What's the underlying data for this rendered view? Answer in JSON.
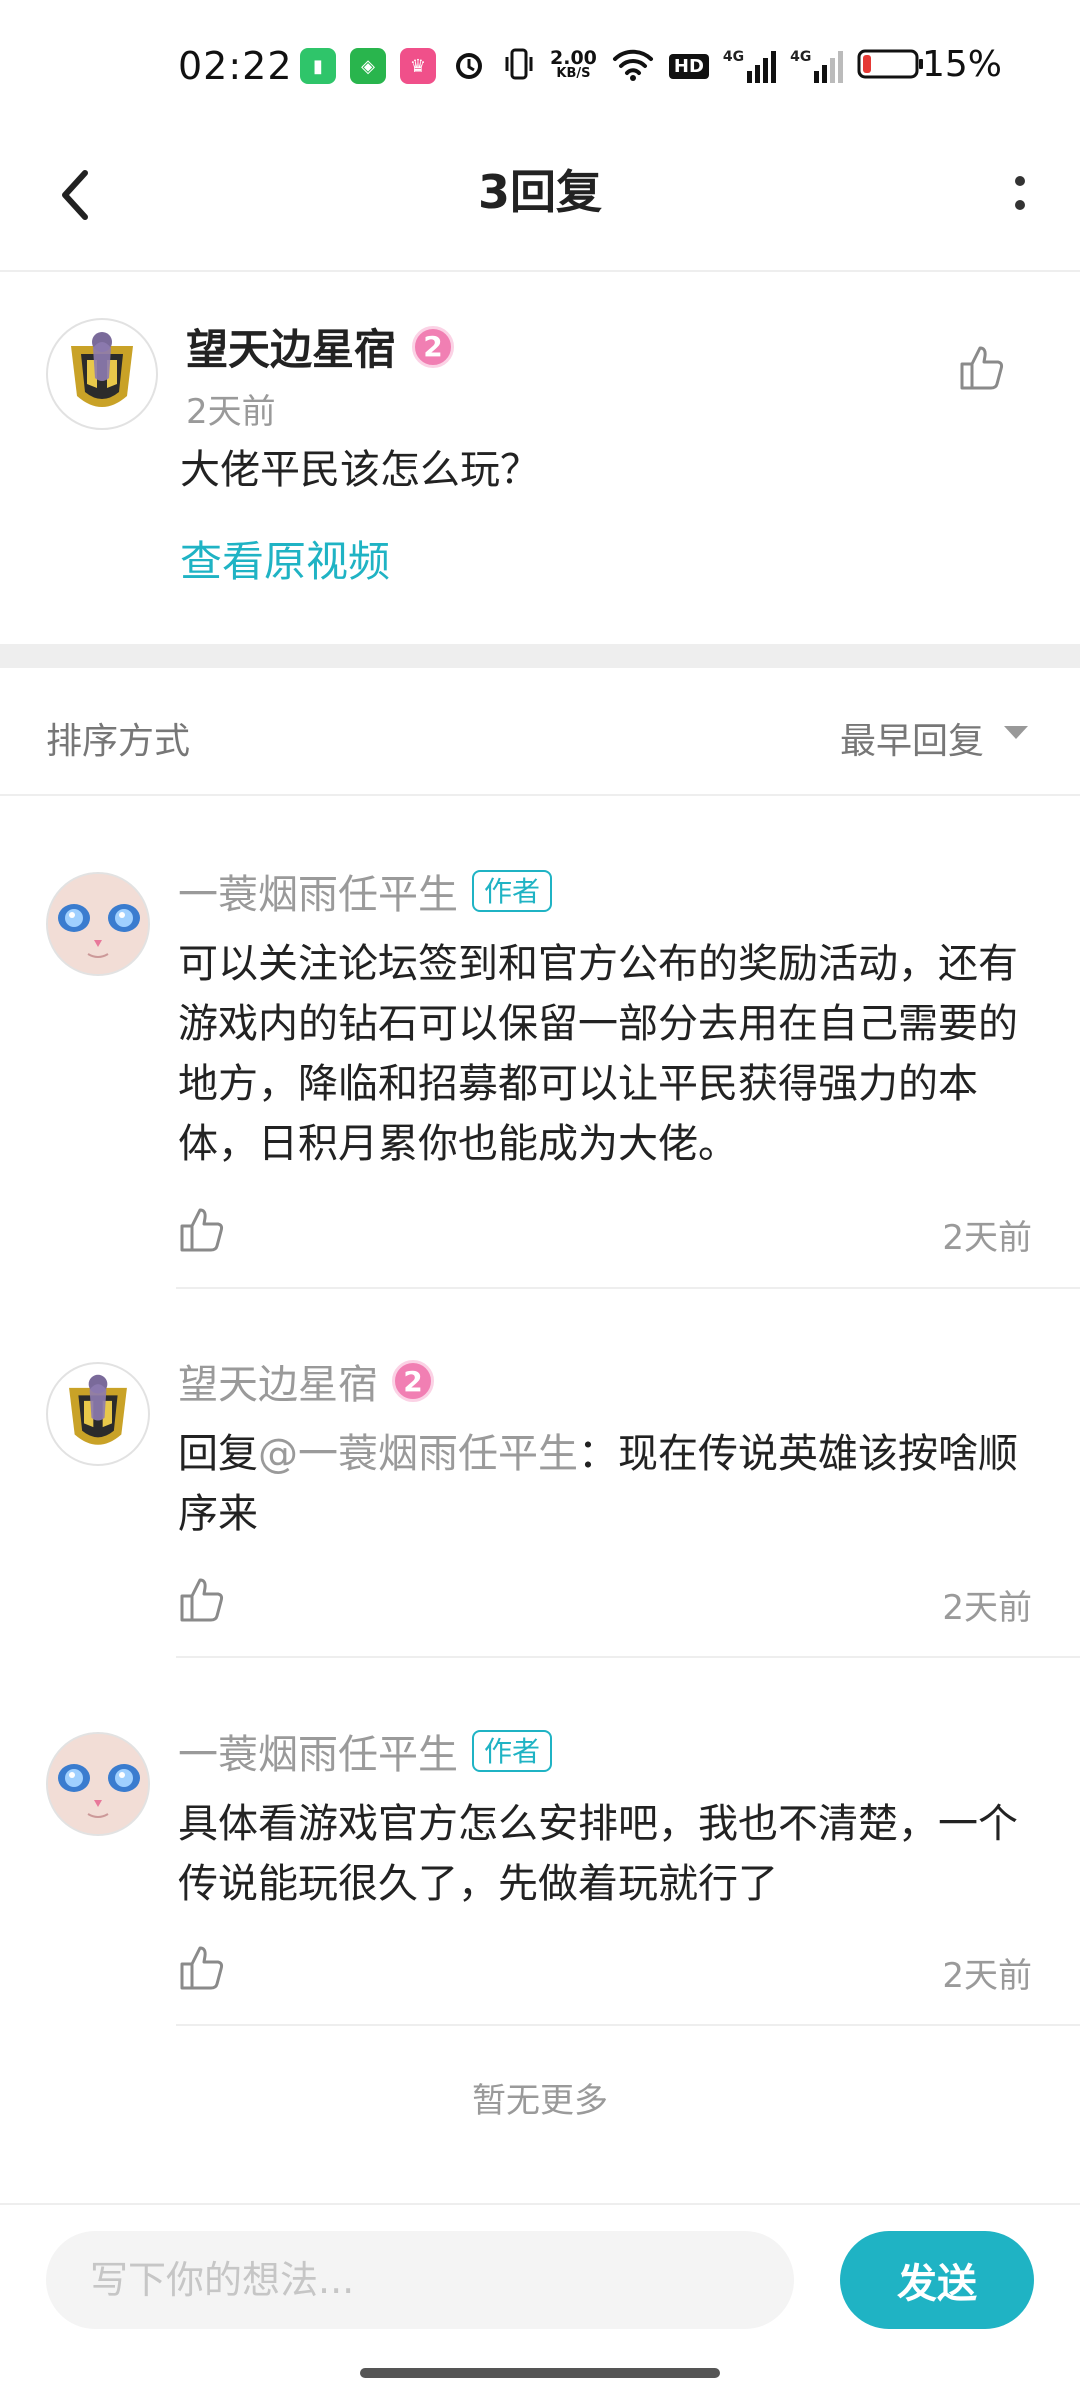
{
  "status_bar": {
    "time": "02:22",
    "net_speed_value": "2.00",
    "net_speed_unit": "KB/S",
    "hd_label": "HD",
    "signal1_label": "4G",
    "signal2_label": "4G",
    "battery_percent": "15%",
    "battery_level": 0.15,
    "colors": {
      "app1": "#2fc56a",
      "app2": "#29b54d",
      "app3": "#f0508a",
      "battery_low": "#e53935"
    }
  },
  "header": {
    "title": "3回复",
    "back_icon": "chevron-left-icon",
    "more_icon": "more-vertical-icon"
  },
  "original_comment": {
    "username": "望天边星宿",
    "level": "2",
    "time": "2天前",
    "text": "大佬平民该怎么玩？",
    "view_video_link": "查看原视频",
    "like_icon": "thumbs-up-icon"
  },
  "sort": {
    "label": "排序方式",
    "selected": "最早回复"
  },
  "replies": [
    {
      "username": "一蓑烟雨任平生",
      "author_tag": "作者",
      "text": "可以关注论坛签到和官方公布的奖励活动，还有游戏内的钻石可以保留一部分去用在自己需要的地方，降临和招募都可以让平民获得强力的本体，日积月累你也能成为大佬。",
      "time": "2天前"
    },
    {
      "username": "望天边星宿",
      "level": "2",
      "reply_prefix": "回复",
      "mention": "@一蓑烟雨任平生",
      "text_after_mention": "：现在传说英雄该按啥顺序来",
      "time": "2天前"
    },
    {
      "username": "一蓑烟雨任平生",
      "author_tag": "作者",
      "text": "具体看游戏官方怎么安排吧，我也不清楚，一个传说能玩很久了，先做着玩就行了",
      "time": "2天前"
    }
  ],
  "no_more_text": "暂无更多",
  "input": {
    "placeholder": "写下你的想法...",
    "value": ""
  },
  "send_button": "发送",
  "colors": {
    "accent": "#1fb3c4",
    "level_badge": "#f17fb3",
    "muted_text": "#9a9a9a"
  }
}
